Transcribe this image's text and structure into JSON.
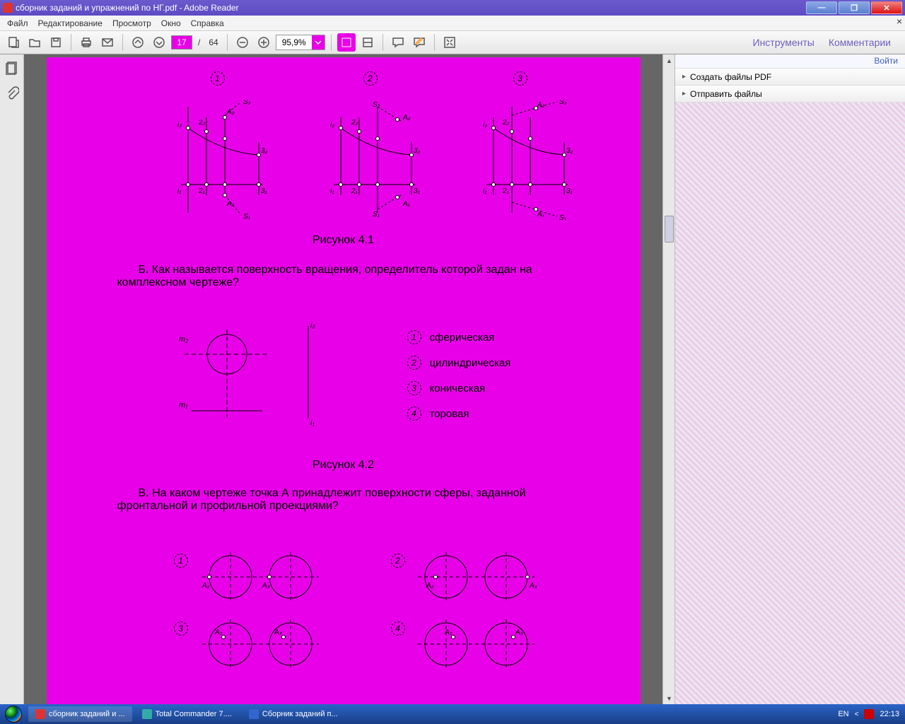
{
  "window": {
    "title": "сборник заданий и упражнений по НГ.pdf - Adobe Reader"
  },
  "menu": {
    "file": "Файл",
    "edit": "Редактирование",
    "view": "Просмотр",
    "window": "Окно",
    "help": "Справка"
  },
  "toolbar": {
    "page_current": "17",
    "page_sep": "/",
    "page_total": "64",
    "zoom": "95,9%",
    "tools": "Инструменты",
    "comments": "Комментарии"
  },
  "rightpane": {
    "login": "Войти",
    "create_pdf": "Создать файлы PDF",
    "send_files": "Отправить файлы"
  },
  "doc": {
    "nums": {
      "n1": "1",
      "n2": "2",
      "n3": "3",
      "n4": "4"
    },
    "labels": {
      "A1": "A₁",
      "A2": "A₂",
      "S1": "S₁",
      "S2": "S₂",
      "i1": "i₁",
      "i2": "i₂",
      "p11": "1₁",
      "p21": "2₁",
      "p31": "3₁",
      "p12": "1₂",
      "p22": "2₂",
      "p32": "3₂",
      "m1": "m₁",
      "m2": "m₂",
      "A3": "A₃"
    },
    "fig41": "Рисунок 4.1",
    "qB": "Б. Как называется поверхность вращения, определитель которой задан на комплексном чертеже?",
    "opts": {
      "o1": "сферическая",
      "o2": "цилиндрическая",
      "o3": "коническая",
      "o4": "торовая"
    },
    "fig42": "Рисунок 4.2",
    "qV": "В. На каком чертеже точка А принадлежит поверхности сферы, заданной фронтальной и профильной проекциями?"
  },
  "taskbar": {
    "t1": "сборник заданий и ...",
    "t2": "Total Commander 7....",
    "t3": "Сборник заданий п...",
    "lang": "EN",
    "clock": "22:13"
  }
}
